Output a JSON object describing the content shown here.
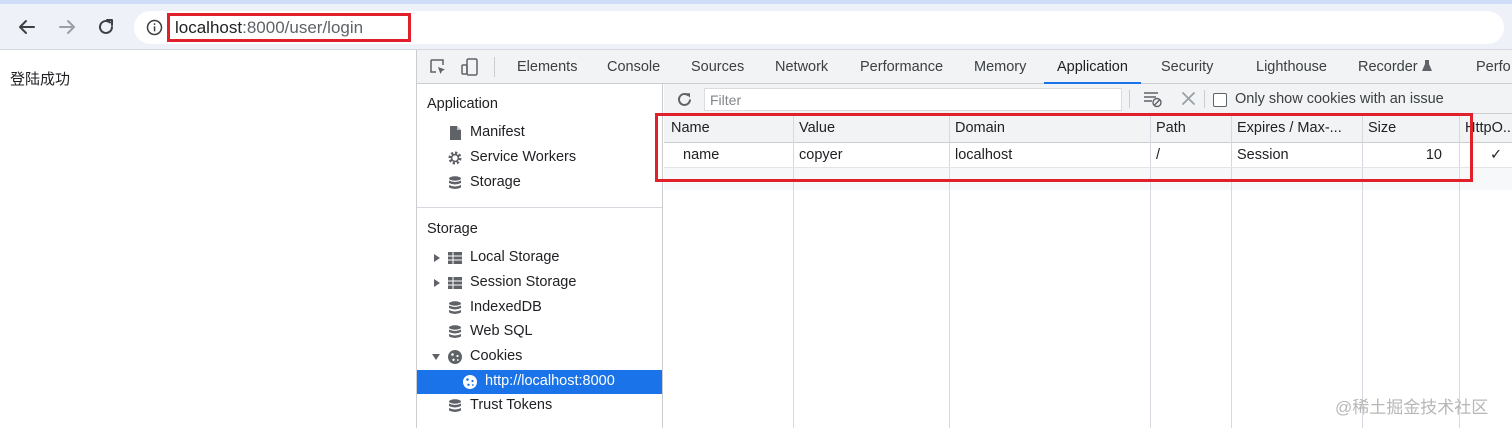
{
  "browser": {
    "back_icon": "arrow-left-icon",
    "forward_icon": "arrow-right-icon",
    "reload_icon": "reload-icon",
    "site_info_icon": "info-circle-icon",
    "url_host": "localhost",
    "url_path": ":8000/user/login",
    "highlight_color": "#e0202a"
  },
  "page": {
    "body_text": "登陆成功"
  },
  "devtools": {
    "inspect_icon": "inspect-element-icon",
    "device_icon": "device-toolbar-icon",
    "tabs": [
      {
        "label": "Elements"
      },
      {
        "label": "Console"
      },
      {
        "label": "Sources"
      },
      {
        "label": "Network"
      },
      {
        "label": "Performance"
      },
      {
        "label": "Memory"
      },
      {
        "label": "Application",
        "active": true
      },
      {
        "label": "Security"
      },
      {
        "label": "Lighthouse"
      },
      {
        "label": "Recorder"
      },
      {
        "label": "Perfo"
      }
    ],
    "accent_color": "#1a73e8"
  },
  "sidebar": {
    "application_title": "Application",
    "application_items": [
      {
        "label": "Manifest",
        "icon": "document-icon"
      },
      {
        "label": "Service Workers",
        "icon": "gear-icon"
      },
      {
        "label": "Storage",
        "icon": "database-icon"
      }
    ],
    "storage_title": "Storage",
    "storage_items": [
      {
        "label": "Local Storage",
        "icon": "grid-icon",
        "expandable": true
      },
      {
        "label": "Session Storage",
        "icon": "grid-icon",
        "expandable": true
      },
      {
        "label": "IndexedDB",
        "icon": "database-icon"
      },
      {
        "label": "Web SQL",
        "icon": "database-icon"
      },
      {
        "label": "Cookies",
        "icon": "cookie-icon",
        "expanded": true
      },
      {
        "label": "http://localhost:8000",
        "icon": "cookie-icon",
        "selected": true
      },
      {
        "label": "Trust Tokens",
        "icon": "database-icon"
      }
    ]
  },
  "cookies": {
    "refresh_icon": "refresh-icon",
    "filter_placeholder": "Filter",
    "filter_value": "",
    "clear_filtered_icon": "clear-filtered-icon",
    "delete_icon": "close-x-icon",
    "only_issues_label": "Only show cookies with an issue",
    "only_issues_checked": false,
    "columns": [
      "Name",
      "Value",
      "Domain",
      "Path",
      "Expires / Max-...",
      "Size",
      "HttpO..."
    ],
    "rows": [
      {
        "name": "name",
        "value": "copyer",
        "domain": "localhost",
        "path": "/",
        "expires": "Session",
        "size": "10",
        "http_only": "✓"
      }
    ]
  },
  "watermark": "@稀土掘金技术社区"
}
